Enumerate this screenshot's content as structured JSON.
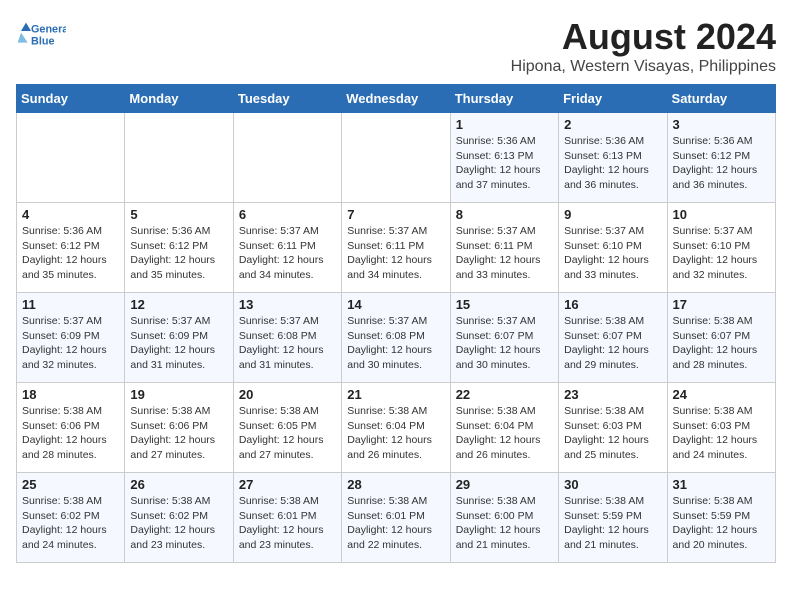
{
  "logo": {
    "line1": "General",
    "line2": "Blue"
  },
  "title": "August 2024",
  "subtitle": "Hipona, Western Visayas, Philippines",
  "days_of_week": [
    "Sunday",
    "Monday",
    "Tuesday",
    "Wednesday",
    "Thursday",
    "Friday",
    "Saturday"
  ],
  "weeks": [
    [
      {
        "day": "",
        "info": ""
      },
      {
        "day": "",
        "info": ""
      },
      {
        "day": "",
        "info": ""
      },
      {
        "day": "",
        "info": ""
      },
      {
        "day": "1",
        "info": "Sunrise: 5:36 AM\nSunset: 6:13 PM\nDaylight: 12 hours\nand 37 minutes."
      },
      {
        "day": "2",
        "info": "Sunrise: 5:36 AM\nSunset: 6:13 PM\nDaylight: 12 hours\nand 36 minutes."
      },
      {
        "day": "3",
        "info": "Sunrise: 5:36 AM\nSunset: 6:12 PM\nDaylight: 12 hours\nand 36 minutes."
      }
    ],
    [
      {
        "day": "4",
        "info": "Sunrise: 5:36 AM\nSunset: 6:12 PM\nDaylight: 12 hours\nand 35 minutes."
      },
      {
        "day": "5",
        "info": "Sunrise: 5:36 AM\nSunset: 6:12 PM\nDaylight: 12 hours\nand 35 minutes."
      },
      {
        "day": "6",
        "info": "Sunrise: 5:37 AM\nSunset: 6:11 PM\nDaylight: 12 hours\nand 34 minutes."
      },
      {
        "day": "7",
        "info": "Sunrise: 5:37 AM\nSunset: 6:11 PM\nDaylight: 12 hours\nand 34 minutes."
      },
      {
        "day": "8",
        "info": "Sunrise: 5:37 AM\nSunset: 6:11 PM\nDaylight: 12 hours\nand 33 minutes."
      },
      {
        "day": "9",
        "info": "Sunrise: 5:37 AM\nSunset: 6:10 PM\nDaylight: 12 hours\nand 33 minutes."
      },
      {
        "day": "10",
        "info": "Sunrise: 5:37 AM\nSunset: 6:10 PM\nDaylight: 12 hours\nand 32 minutes."
      }
    ],
    [
      {
        "day": "11",
        "info": "Sunrise: 5:37 AM\nSunset: 6:09 PM\nDaylight: 12 hours\nand 32 minutes."
      },
      {
        "day": "12",
        "info": "Sunrise: 5:37 AM\nSunset: 6:09 PM\nDaylight: 12 hours\nand 31 minutes."
      },
      {
        "day": "13",
        "info": "Sunrise: 5:37 AM\nSunset: 6:08 PM\nDaylight: 12 hours\nand 31 minutes."
      },
      {
        "day": "14",
        "info": "Sunrise: 5:37 AM\nSunset: 6:08 PM\nDaylight: 12 hours\nand 30 minutes."
      },
      {
        "day": "15",
        "info": "Sunrise: 5:37 AM\nSunset: 6:07 PM\nDaylight: 12 hours\nand 30 minutes."
      },
      {
        "day": "16",
        "info": "Sunrise: 5:38 AM\nSunset: 6:07 PM\nDaylight: 12 hours\nand 29 minutes."
      },
      {
        "day": "17",
        "info": "Sunrise: 5:38 AM\nSunset: 6:07 PM\nDaylight: 12 hours\nand 28 minutes."
      }
    ],
    [
      {
        "day": "18",
        "info": "Sunrise: 5:38 AM\nSunset: 6:06 PM\nDaylight: 12 hours\nand 28 minutes."
      },
      {
        "day": "19",
        "info": "Sunrise: 5:38 AM\nSunset: 6:06 PM\nDaylight: 12 hours\nand 27 minutes."
      },
      {
        "day": "20",
        "info": "Sunrise: 5:38 AM\nSunset: 6:05 PM\nDaylight: 12 hours\nand 27 minutes."
      },
      {
        "day": "21",
        "info": "Sunrise: 5:38 AM\nSunset: 6:04 PM\nDaylight: 12 hours\nand 26 minutes."
      },
      {
        "day": "22",
        "info": "Sunrise: 5:38 AM\nSunset: 6:04 PM\nDaylight: 12 hours\nand 26 minutes."
      },
      {
        "day": "23",
        "info": "Sunrise: 5:38 AM\nSunset: 6:03 PM\nDaylight: 12 hours\nand 25 minutes."
      },
      {
        "day": "24",
        "info": "Sunrise: 5:38 AM\nSunset: 6:03 PM\nDaylight: 12 hours\nand 24 minutes."
      }
    ],
    [
      {
        "day": "25",
        "info": "Sunrise: 5:38 AM\nSunset: 6:02 PM\nDaylight: 12 hours\nand 24 minutes."
      },
      {
        "day": "26",
        "info": "Sunrise: 5:38 AM\nSunset: 6:02 PM\nDaylight: 12 hours\nand 23 minutes."
      },
      {
        "day": "27",
        "info": "Sunrise: 5:38 AM\nSunset: 6:01 PM\nDaylight: 12 hours\nand 23 minutes."
      },
      {
        "day": "28",
        "info": "Sunrise: 5:38 AM\nSunset: 6:01 PM\nDaylight: 12 hours\nand 22 minutes."
      },
      {
        "day": "29",
        "info": "Sunrise: 5:38 AM\nSunset: 6:00 PM\nDaylight: 12 hours\nand 21 minutes."
      },
      {
        "day": "30",
        "info": "Sunrise: 5:38 AM\nSunset: 5:59 PM\nDaylight: 12 hours\nand 21 minutes."
      },
      {
        "day": "31",
        "info": "Sunrise: 5:38 AM\nSunset: 5:59 PM\nDaylight: 12 hours\nand 20 minutes."
      }
    ]
  ]
}
